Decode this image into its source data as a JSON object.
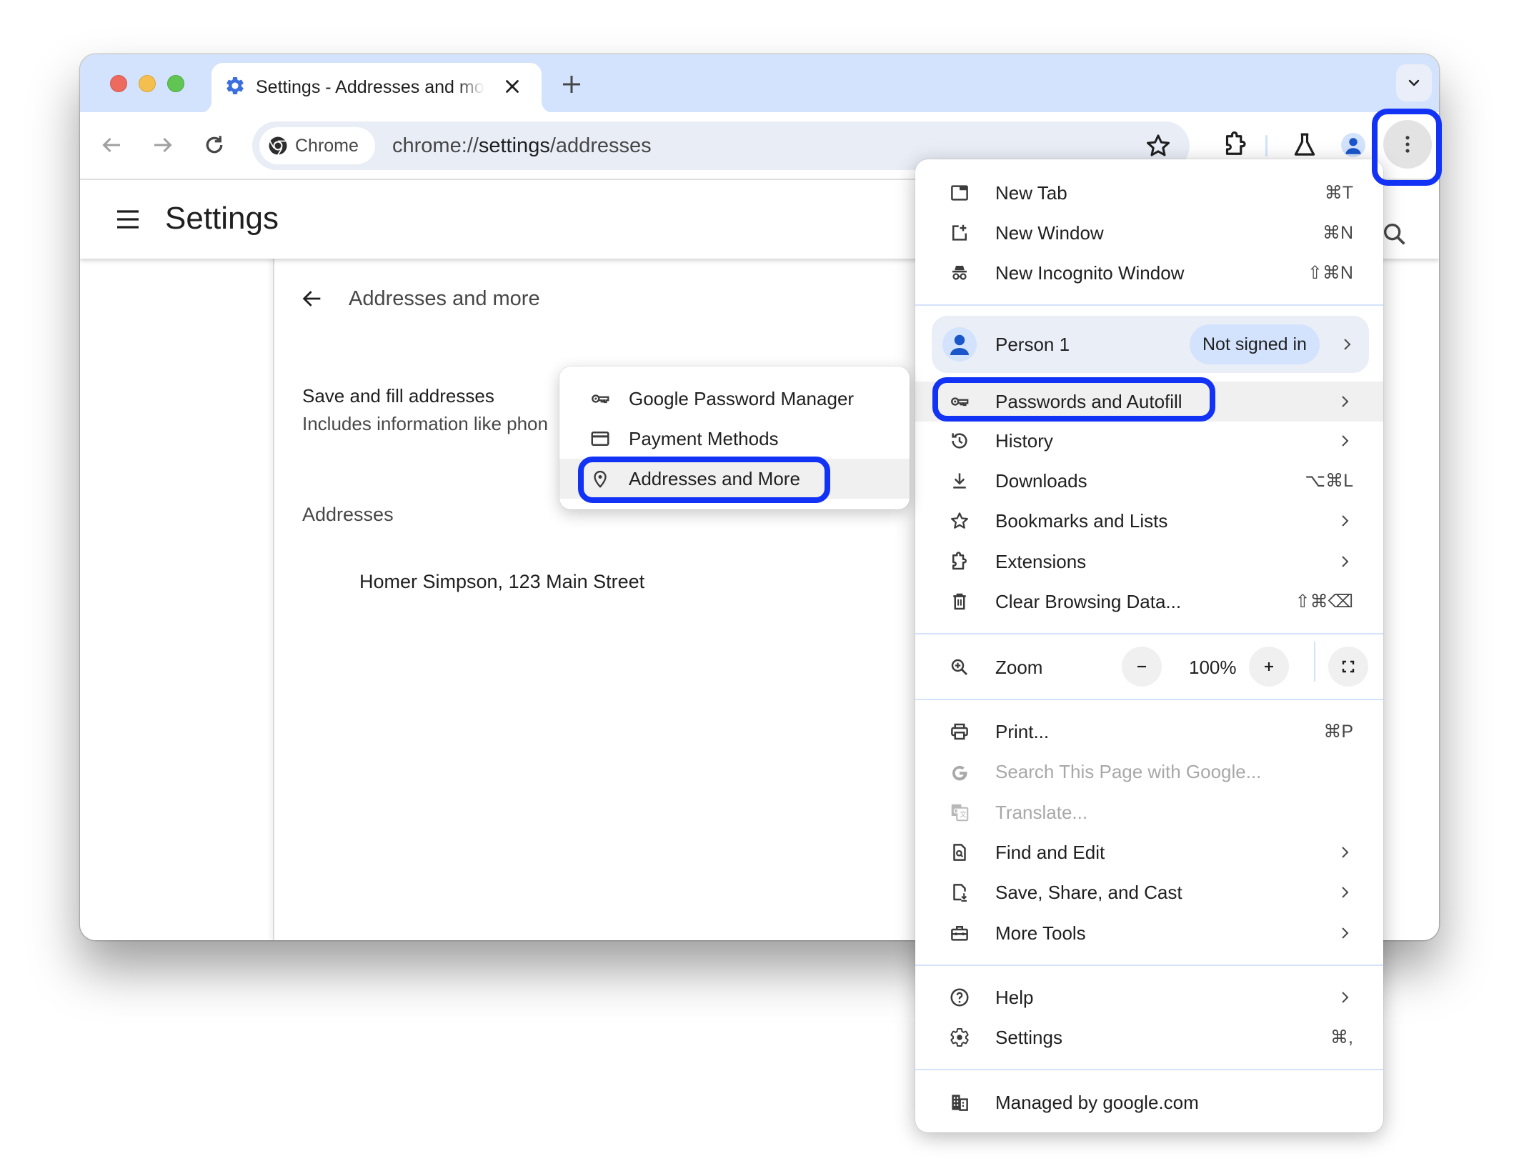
{
  "window": {
    "tab": {
      "title": "Settings - Addresses and more",
      "favicon": "settings-gear-icon"
    },
    "omnibox": {
      "chip_label": "Chrome",
      "url_prefix": "chrome://",
      "url_host": "settings",
      "url_path": "/addresses"
    },
    "colors": {
      "tabstrip": "#d3e3fd",
      "accent_blue": "#3b6fe0",
      "annotation": "#1233f5"
    }
  },
  "settings": {
    "title": "Settings",
    "page": {
      "subtitle": "Addresses and more",
      "toggle_title": "Save and fill addresses",
      "toggle_description": "Includes information like phon",
      "section_label": "Addresses",
      "addresses": [
        "Homer Simpson, 123 Main Street"
      ]
    }
  },
  "app_menu": {
    "group1": [
      {
        "label": "New Tab",
        "shortcut": "⌘T",
        "icon": "new-tab-icon"
      },
      {
        "label": "New Window",
        "shortcut": "⌘N",
        "icon": "new-window-icon"
      },
      {
        "label": "New Incognito Window",
        "shortcut": "⇧⌘N",
        "icon": "incognito-icon"
      }
    ],
    "profile": {
      "name": "Person 1",
      "status": "Not signed in"
    },
    "group2": [
      {
        "label": "Passwords and Autofill",
        "submenu": true,
        "icon": "key-icon",
        "highlighted": true
      },
      {
        "label": "History",
        "submenu": true,
        "icon": "history-icon"
      },
      {
        "label": "Downloads",
        "shortcut": "⌥⌘L",
        "icon": "download-icon"
      },
      {
        "label": "Bookmarks and Lists",
        "submenu": true,
        "icon": "star-icon"
      },
      {
        "label": "Extensions",
        "submenu": true,
        "icon": "extension-icon"
      },
      {
        "label": "Clear Browsing Data...",
        "shortcut": "⇧⌘⌫",
        "icon": "trash-icon"
      }
    ],
    "zoom": {
      "label": "Zoom",
      "value": "100%",
      "minus": "−",
      "plus": "+"
    },
    "group3": [
      {
        "label": "Print...",
        "shortcut": "⌘P",
        "icon": "print-icon"
      },
      {
        "label": "Search This Page with Google...",
        "disabled": true,
        "icon": "google-g-icon"
      },
      {
        "label": "Translate...",
        "disabled": true,
        "icon": "translate-icon"
      },
      {
        "label": "Find and Edit",
        "submenu": true,
        "icon": "find-page-icon"
      },
      {
        "label": "Save, Share, and Cast",
        "submenu": true,
        "icon": "save-share-icon"
      },
      {
        "label": "More Tools",
        "submenu": true,
        "icon": "toolbox-icon"
      }
    ],
    "group4": [
      {
        "label": "Help",
        "submenu": true,
        "icon": "help-icon"
      },
      {
        "label": "Settings",
        "shortcut": "⌘,",
        "icon": "gear-icon"
      }
    ],
    "managed": {
      "label": "Managed by google.com",
      "icon": "building-icon"
    }
  },
  "autofill_submenu": {
    "items": [
      {
        "label": "Google Password Manager",
        "icon": "key-icon"
      },
      {
        "label": "Payment Methods",
        "icon": "credit-card-icon"
      },
      {
        "label": "Addresses and More",
        "icon": "location-pin-icon",
        "highlighted": true
      }
    ]
  }
}
